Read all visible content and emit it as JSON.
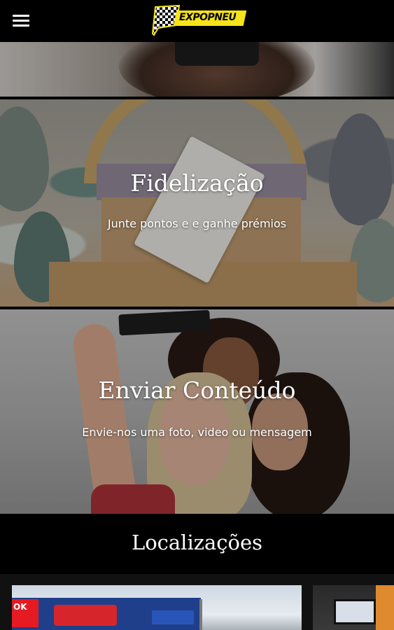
{
  "header": {
    "logo_text": "EXPOPNEU",
    "menu_icon": "hamburger-menu-icon"
  },
  "cards": [
    {
      "title": "Fidelização",
      "subtitle": "Junte pontos e e ganhe prémios"
    },
    {
      "title": "Enviar Conteúdo",
      "subtitle": "Envie-nos uma foto, video ou mensagem"
    }
  ],
  "locations": {
    "title": "Localizações",
    "store_sign_text": "OK"
  },
  "colors": {
    "background": "#000000",
    "logo_yellow": "#f7e31a",
    "text": "#ffffff"
  }
}
